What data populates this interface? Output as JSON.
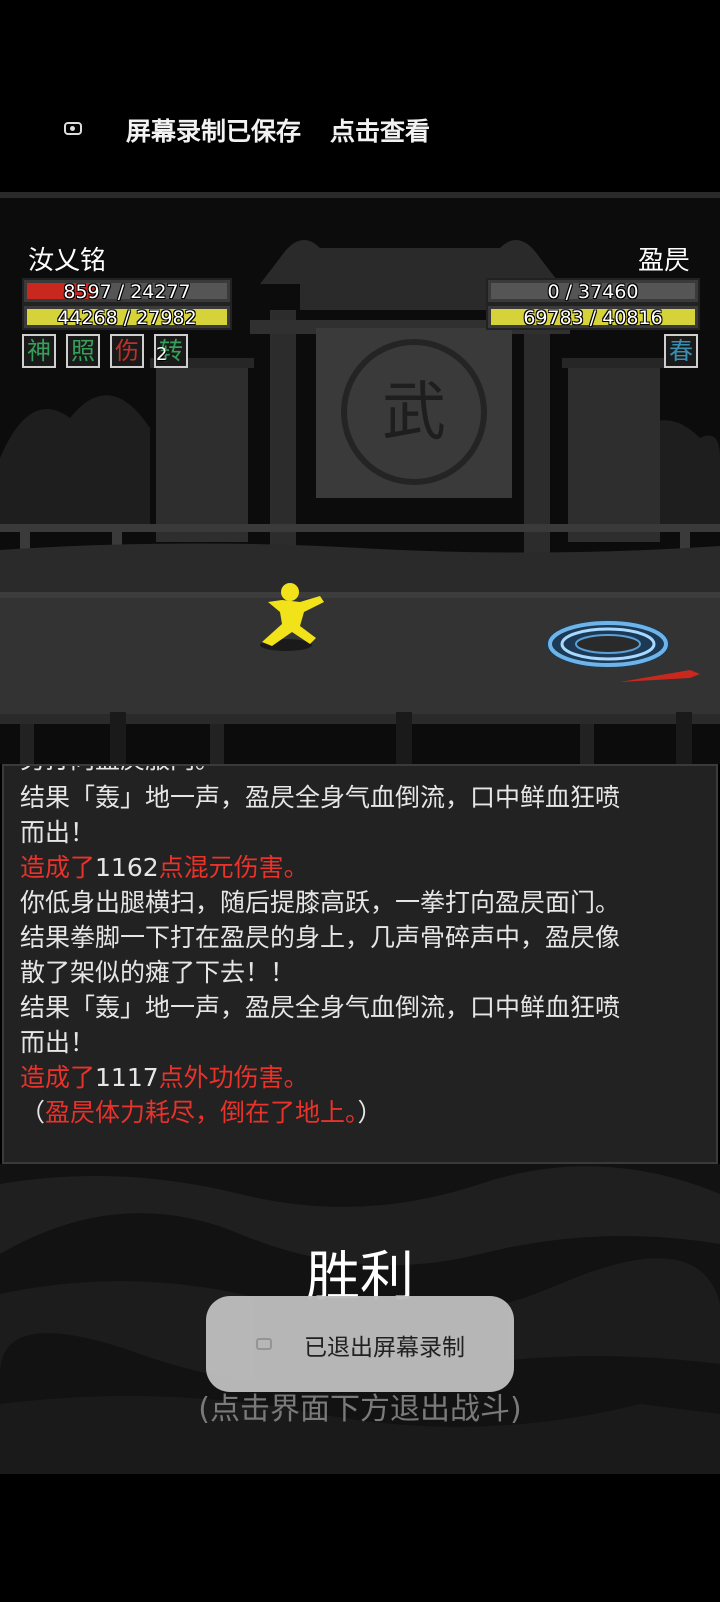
{
  "notification": {
    "text": "屏幕录制已保存",
    "action": "点击查看",
    "icon": "screen-record-icon"
  },
  "player": {
    "name": "汝乂铭",
    "hp_text": "8597 / 24277",
    "hp_fraction": 0.354,
    "mp_text": "44268 / 27982",
    "mp_fraction": 1.0,
    "statuses": [
      {
        "label": "神",
        "color": "#36a05a"
      },
      {
        "label": "照",
        "color": "#36a05a"
      },
      {
        "label": "伤",
        "color": "#c0302a"
      },
      {
        "label": "转",
        "color": "#36a05a",
        "count": "2"
      }
    ]
  },
  "enemy": {
    "name": "盈昃",
    "hp_text": "0 / 37460",
    "hp_fraction": 0,
    "mp_text": "69783 / 40816",
    "mp_fraction": 1.0,
    "statuses": [
      {
        "label": "春",
        "color": "#3a8fb0"
      }
    ]
  },
  "scene": {
    "gate_emblem": "武"
  },
  "log": {
    "clipped_line": "另打向盈昃服门。",
    "lines": [
      {
        "parts": [
          {
            "t": "结果「轰」地一声，盈昃全身气血倒流，口中鲜血狂喷",
            "red": false
          }
        ]
      },
      {
        "parts": [
          {
            "t": "而出！",
            "red": false
          }
        ]
      },
      {
        "parts": [
          {
            "t": "造成了",
            "red": true
          },
          {
            "t": "1162",
            "red": false
          },
          {
            "t": "点混元伤害。",
            "red": true
          }
        ]
      },
      {
        "parts": [
          {
            "t": "你低身出腿横扫，随后提膝高跃，一拳打向盈昃面门。",
            "red": false
          }
        ]
      },
      {
        "parts": [
          {
            "t": "结果拳脚一下打在盈昃的身上，几声骨碎声中，盈昃像",
            "red": false
          }
        ]
      },
      {
        "parts": [
          {
            "t": "散了架似的瘫了下去！！",
            "red": false
          }
        ]
      },
      {
        "parts": [
          {
            "t": "结果「轰」地一声，盈昃全身气血倒流，口中鲜血狂喷",
            "red": false
          }
        ]
      },
      {
        "parts": [
          {
            "t": "而出！",
            "red": false
          }
        ]
      },
      {
        "parts": [
          {
            "t": "造成了",
            "red": true
          },
          {
            "t": "1117",
            "red": false
          },
          {
            "t": "点外功伤害。",
            "red": true
          }
        ]
      },
      {
        "parts": [
          {
            "t": "（",
            "red": false
          },
          {
            "t": "盈昃体力耗尽，倒在了地上。",
            "red": true
          },
          {
            "t": "）",
            "red": false
          }
        ]
      }
    ]
  },
  "result": {
    "title": "胜利",
    "hint": "(点击界面下方退出战斗)"
  },
  "toast": {
    "text": "已退出屏幕录制",
    "icon": "screen-record-icon"
  },
  "colors": {
    "hp": "#c8281e",
    "mp": "#d6d23a",
    "hero": "#f2e21a",
    "log_red": "#e8322a"
  }
}
